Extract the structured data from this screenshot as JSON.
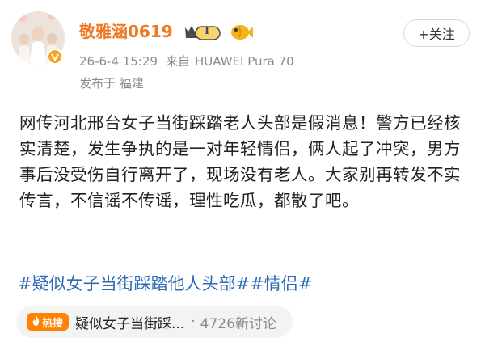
{
  "post": {
    "username": "敬雅涵0619",
    "level_label": "I",
    "follow_label": "+关注",
    "date": "26-6-4 15:29",
    "source_prefix": "来自",
    "device": "HUAWEI Pura 70",
    "location_label": "发布于 福建",
    "body": "网传河北邢台女子当街踩踏老人头部是假消息！警方已经核实清楚，发生争执的是一对年轻情侣，俩人起了冲突，男方事后没受伤自行离开了，现场没有老人。大家别再转发不实传言，不信谣不传谣，理性吃瓜，都散了吧。",
    "hashtags": "#疑似女子当街踩踏他人头部##情侣#"
  },
  "hot": {
    "badge": "热搜",
    "title": "疑似女子当街踩...",
    "separator": "·",
    "count": "4726新讨论"
  },
  "colors": {
    "username": "#ee7a25",
    "hashtag": "#2f6bb5",
    "hot_badge": "#ff8200",
    "meta": "#8b8b8b"
  },
  "icons": [
    "avatar",
    "verified-badge-icon",
    "level-badge-icon",
    "fish-badge-icon",
    "flame-icon"
  ]
}
